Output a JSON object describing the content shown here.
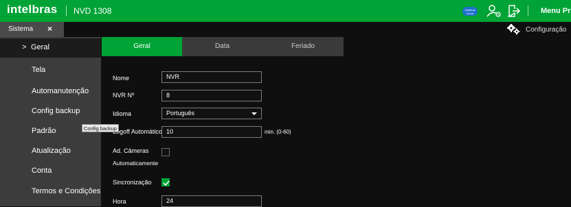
{
  "header": {
    "logo": "intelbras",
    "model": "NVD 1308",
    "cloud_badge": "Intelbras Cloud",
    "menu_principal": "Menu Principal"
  },
  "tabs": {
    "sistema": "Sistema",
    "close": "×",
    "configuracao": "Configuração"
  },
  "sidebar": {
    "chevron": ">",
    "items": [
      {
        "label": "Geral",
        "active": true
      },
      {
        "label": "Tela"
      },
      {
        "label": "Automanutenção"
      },
      {
        "label": "Config backup"
      },
      {
        "label": "Padrão"
      },
      {
        "label": "Atualização"
      },
      {
        "label": "Conta"
      },
      {
        "label": "Termos e Condições"
      }
    ],
    "tooltip": "Config backup"
  },
  "content_tabs": [
    "Geral",
    "Data",
    "Feriado"
  ],
  "form": {
    "nome_label": "Nome",
    "nome_value": "NVR",
    "nvr_label": "NVR Nº",
    "nvr_value": "8",
    "idioma_label": "Idioma",
    "idioma_value": "Português",
    "logoff_label": "Logoff Automático",
    "logoff_value": "10",
    "logoff_hint": "min. (0-60)",
    "ad_cameras_label_1": "Ad. Câmeras",
    "ad_cameras_label_2": "Automaticamente",
    "ad_cameras_checked": false,
    "sincronizacao_label": "Sincronização",
    "sincronizacao_checked": true,
    "hora_label": "Hora",
    "hora_value": "24"
  },
  "colors": {
    "brand_green": "#00a335",
    "sidebar_bg": "#3c3c3c",
    "page_bg": "#0f0f0f"
  }
}
